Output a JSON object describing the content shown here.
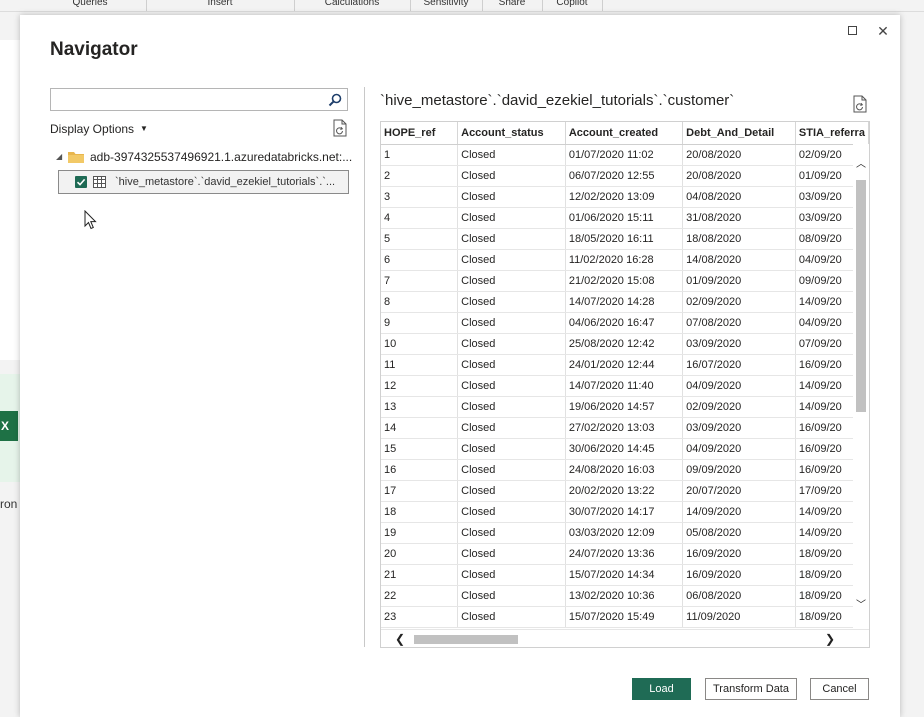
{
  "ribbon": {
    "groups": [
      "Queries",
      "Insert",
      "Calculations",
      "Sensitivity",
      "Share",
      "Copilot"
    ]
  },
  "background": {
    "excel_glyph": "X",
    "partial_label": "ron"
  },
  "dialog": {
    "title": "Navigator",
    "maximize_icon": "maximize-icon",
    "close_glyph": "✕"
  },
  "left_pane": {
    "search": {
      "value": "",
      "placeholder": ""
    },
    "display_options_label": "Display Options",
    "tree": {
      "root_label": "adb-3974325537496921.1.azuredatabricks.net:...",
      "item_label": "`hive_metastore`.`david_ezekiel_tutorials`.`...",
      "item_checked": true
    }
  },
  "preview": {
    "title": "`hive_metastore`.`david_ezekiel_tutorials`.`customer`",
    "columns": [
      "HOPE_ref",
      "Account_status",
      "Account_created",
      "Debt_And_Detail",
      "STIA_referra"
    ],
    "rows": [
      [
        "1",
        "Closed",
        "01/07/2020 11:02",
        "20/08/2020",
        "02/09/20"
      ],
      [
        "2",
        "Closed",
        "06/07/2020 12:55",
        "20/08/2020",
        "01/09/20"
      ],
      [
        "3",
        "Closed",
        "12/02/2020 13:09",
        "04/08/2020",
        "03/09/20"
      ],
      [
        "4",
        "Closed",
        "01/06/2020 15:11",
        "31/08/2020",
        "03/09/20"
      ],
      [
        "5",
        "Closed",
        "18/05/2020 16:11",
        "18/08/2020",
        "08/09/20"
      ],
      [
        "6",
        "Closed",
        "11/02/2020 16:28",
        "14/08/2020",
        "04/09/20"
      ],
      [
        "7",
        "Closed",
        "21/02/2020 15:08",
        "01/09/2020",
        "09/09/20"
      ],
      [
        "8",
        "Closed",
        "14/07/2020 14:28",
        "02/09/2020",
        "14/09/20"
      ],
      [
        "9",
        "Closed",
        "04/06/2020 16:47",
        "07/08/2020",
        "04/09/20"
      ],
      [
        "10",
        "Closed",
        "25/08/2020 12:42",
        "03/09/2020",
        "07/09/20"
      ],
      [
        "11",
        "Closed",
        "24/01/2020 12:44",
        "16/07/2020",
        "16/09/20"
      ],
      [
        "12",
        "Closed",
        "14/07/2020 11:40",
        "04/09/2020",
        "14/09/20"
      ],
      [
        "13",
        "Closed",
        "19/06/2020 14:57",
        "02/09/2020",
        "14/09/20"
      ],
      [
        "14",
        "Closed",
        "27/02/2020 13:03",
        "03/09/2020",
        "16/09/20"
      ],
      [
        "15",
        "Closed",
        "30/06/2020 14:45",
        "04/09/2020",
        "16/09/20"
      ],
      [
        "16",
        "Closed",
        "24/08/2020 16:03",
        "09/09/2020",
        "16/09/20"
      ],
      [
        "17",
        "Closed",
        "20/02/2020 13:22",
        "20/07/2020",
        "17/09/20"
      ],
      [
        "18",
        "Closed",
        "30/07/2020 14:17",
        "14/09/2020",
        "14/09/20"
      ],
      [
        "19",
        "Closed",
        "03/03/2020 12:09",
        "05/08/2020",
        "14/09/20"
      ],
      [
        "20",
        "Closed",
        "24/07/2020 13:36",
        "16/09/2020",
        "18/09/20"
      ],
      [
        "21",
        "Closed",
        "15/07/2020 14:34",
        "16/09/2020",
        "18/09/20"
      ],
      [
        "22",
        "Closed",
        "13/02/2020 10:36",
        "06/08/2020",
        "18/09/20"
      ],
      [
        "23",
        "Closed",
        "15/07/2020 15:49",
        "11/09/2020",
        "18/09/20"
      ]
    ]
  },
  "footer": {
    "load_label": "Load",
    "transform_label": "Transform Data",
    "cancel_label": "Cancel"
  },
  "colors": {
    "primary": "#1f6b55",
    "excel": "#1e7145"
  }
}
